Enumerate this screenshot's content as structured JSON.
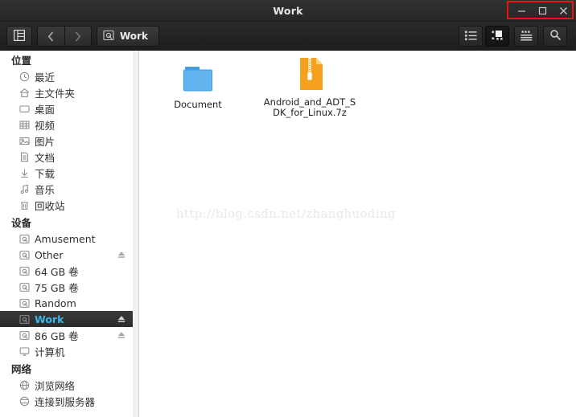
{
  "window": {
    "title": "Work",
    "controls": [
      {
        "name": "minimize-button",
        "glyph": "minimize"
      },
      {
        "name": "maximize-button",
        "glyph": "maximize"
      },
      {
        "name": "close-button",
        "glyph": "close"
      }
    ],
    "highlight_color": "#e81313"
  },
  "toolbar": {
    "sidebar_toggle": "sidebar-toggle-icon",
    "back_label": "‹",
    "forward_label": "›",
    "path_label": "Work",
    "path_icon": "drive-icon",
    "view_list": "list-view-icon",
    "view_icons": "icon-view-icon",
    "view_compact": "compact-view-icon",
    "search": "search-icon"
  },
  "sidebar": {
    "sections": [
      {
        "header": "位置",
        "items": [
          {
            "label": "最近",
            "icon": "clock-icon",
            "eject": false,
            "selected": false
          },
          {
            "label": "主文件夹",
            "icon": "home-icon",
            "eject": false,
            "selected": false
          },
          {
            "label": "桌面",
            "icon": "desktop-icon",
            "eject": false,
            "selected": false
          },
          {
            "label": "视频",
            "icon": "video-icon",
            "eject": false,
            "selected": false
          },
          {
            "label": "图片",
            "icon": "picture-icon",
            "eject": false,
            "selected": false
          },
          {
            "label": "文档",
            "icon": "document-icon",
            "eject": false,
            "selected": false
          },
          {
            "label": "下载",
            "icon": "download-icon",
            "eject": false,
            "selected": false
          },
          {
            "label": "音乐",
            "icon": "music-icon",
            "eject": false,
            "selected": false
          },
          {
            "label": "回收站",
            "icon": "trash-icon",
            "eject": false,
            "selected": false
          }
        ]
      },
      {
        "header": "设备",
        "items": [
          {
            "label": "Amusement",
            "icon": "drive-icon",
            "eject": false,
            "selected": false
          },
          {
            "label": "Other",
            "icon": "drive-icon",
            "eject": true,
            "selected": false
          },
          {
            "label": "64 GB 卷",
            "icon": "drive-icon",
            "eject": false,
            "selected": false
          },
          {
            "label": "75 GB 卷",
            "icon": "drive-icon",
            "eject": false,
            "selected": false
          },
          {
            "label": "Random",
            "icon": "drive-icon",
            "eject": false,
            "selected": false
          },
          {
            "label": "Work",
            "icon": "drive-icon",
            "eject": true,
            "selected": true
          },
          {
            "label": "86 GB 卷",
            "icon": "drive-icon",
            "eject": true,
            "selected": false
          },
          {
            "label": "计算机",
            "icon": "computer-icon",
            "eject": false,
            "selected": false
          }
        ]
      },
      {
        "header": "网络",
        "items": [
          {
            "label": "浏览网络",
            "icon": "network-icon",
            "eject": false,
            "selected": false
          },
          {
            "label": "连接到服务器",
            "icon": "connect-icon",
            "eject": false,
            "selected": false
          }
        ]
      }
    ]
  },
  "content": {
    "items": [
      {
        "name": "Document",
        "type": "folder"
      },
      {
        "name": "Android_and_ADT_SDK_for_Linux.7z",
        "type": "archive"
      }
    ],
    "watermark": "http://blog.csdn.net/zhanghuoding"
  }
}
